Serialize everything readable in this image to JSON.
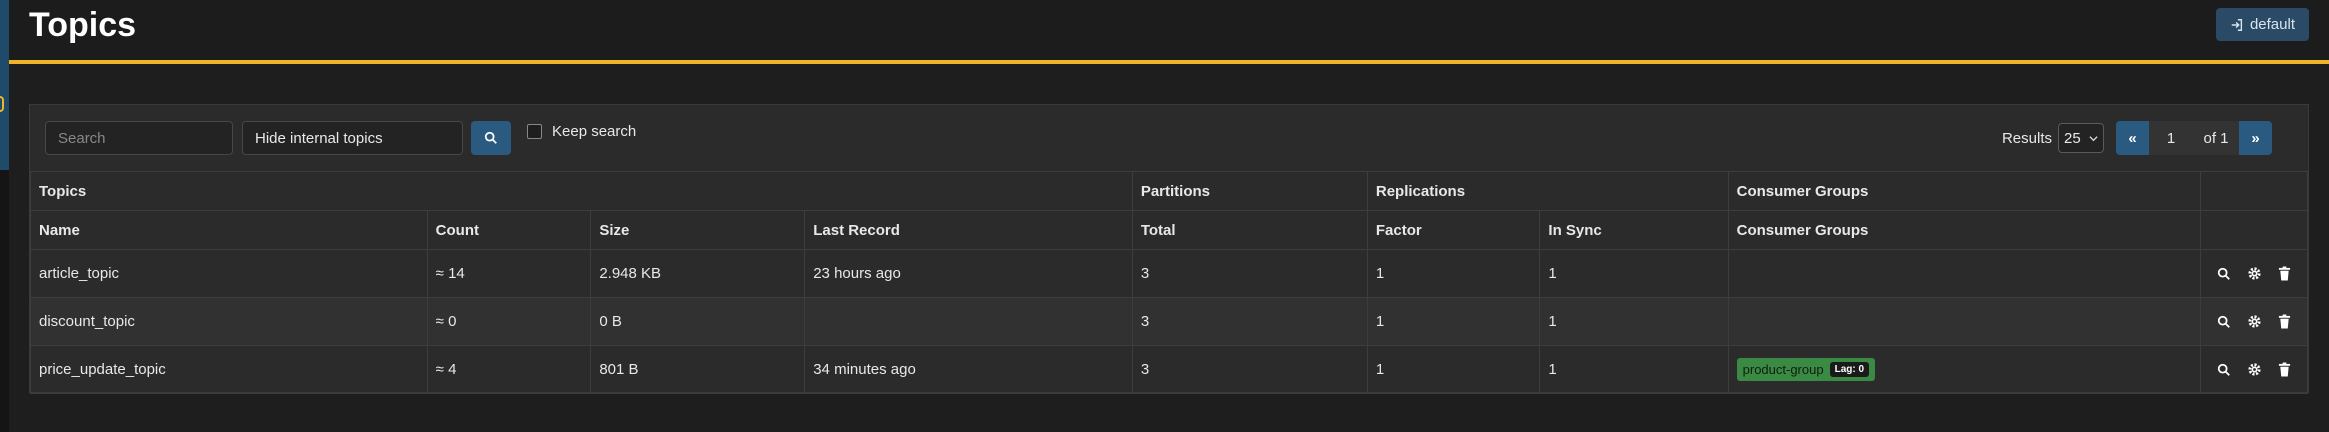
{
  "header": {
    "title": "Topics",
    "context_button": "default"
  },
  "toolbar": {
    "search_placeholder": "Search",
    "filter_value": "Hide internal topics",
    "keep_search_label": "Keep search",
    "results_label": "Results",
    "page_size": "25",
    "pager": {
      "prev": "«",
      "page": "1",
      "of": "of 1",
      "next": "»"
    }
  },
  "table": {
    "groups": [
      "Topics",
      "Partitions",
      "Replications",
      "Consumer Groups",
      ""
    ],
    "columns": [
      "Name",
      "Count",
      "Size",
      "Last Record",
      "Total",
      "Factor",
      "In Sync",
      "Consumer Groups"
    ],
    "rows": [
      {
        "name": "article_topic",
        "count": "≈ 14",
        "size": "2.948 KB",
        "last": "23 hours ago",
        "total": "3",
        "factor": "1",
        "insync": "1",
        "group": "",
        "lag": ""
      },
      {
        "name": "discount_topic",
        "count": "≈ 0",
        "size": "0 B",
        "last": "",
        "total": "3",
        "factor": "1",
        "insync": "1",
        "group": "",
        "lag": ""
      },
      {
        "name": "price_update_topic",
        "count": "≈ 4",
        "size": "801 B",
        "last": "34 minutes ago",
        "total": "3",
        "factor": "1",
        "insync": "1",
        "group": "product-group",
        "lag": "Lag: 0"
      }
    ]
  },
  "icons": {
    "search": "search-icon",
    "settings": "gear-icon",
    "delete": "trash-icon",
    "login": "sign-in-icon"
  },
  "colors": {
    "accent": "#f0b429",
    "primary": "#2a5a80",
    "badge": "#3a8a44"
  }
}
